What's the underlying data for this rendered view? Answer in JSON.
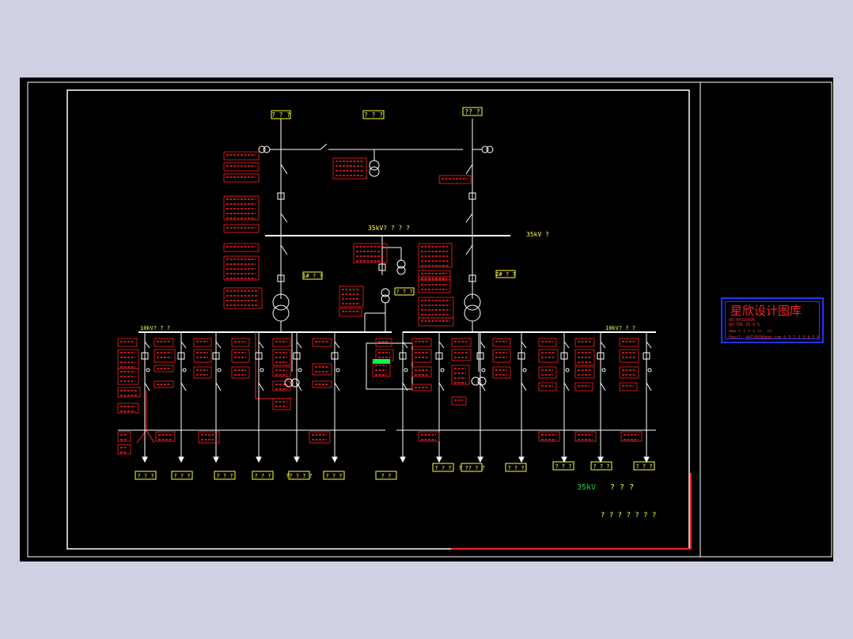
{
  "colors": {
    "background": "#000000",
    "frame": "#ffffff",
    "wire": "#ffffff",
    "device_text": "#ff2020",
    "label_text": "#ffff40",
    "highlight": "#00ff40",
    "logo_border": "#2233ff"
  },
  "top_labels": {
    "left_incoming": "? ? ?",
    "center": "? ? ?",
    "right_incoming": "?? ?"
  },
  "busbar_labels": {
    "hv_bus": "35kV? ? ? ?",
    "hv_bus_right": "35kV ?",
    "lv_bus_left": "10kV? ? ?",
    "lv_bus_right": "10kV? ? ?"
  },
  "transformer_labels": {
    "t1": "1# ? ?",
    "t2": "2# ? ?",
    "station": "? ? ?"
  },
  "feeder_labels": [
    "? ? ?",
    "? ? ?",
    "? ? ?",
    "? ? ?",
    "?? ? ? ?",
    "? ? ?",
    "? ?",
    "? ? ?",
    "? ?? ? ?",
    "? ? ?",
    "? ? ?",
    "? ? ?",
    "? ? ?"
  ],
  "voltage_note": "35kV",
  "voltage_note_suffix": "? ? ?",
  "bottom_note": "? ? ? ? ? ? ?",
  "logo": {
    "title": "星欣设计图库",
    "line1": "QQ:44726696",
    "line2": "QQ:706 20 9 5",
    "line3": "www.x i n s  sc. cn",
    "line4": "Email: 44726696@qq.com 6 3 1 3 9 8 6 6"
  }
}
